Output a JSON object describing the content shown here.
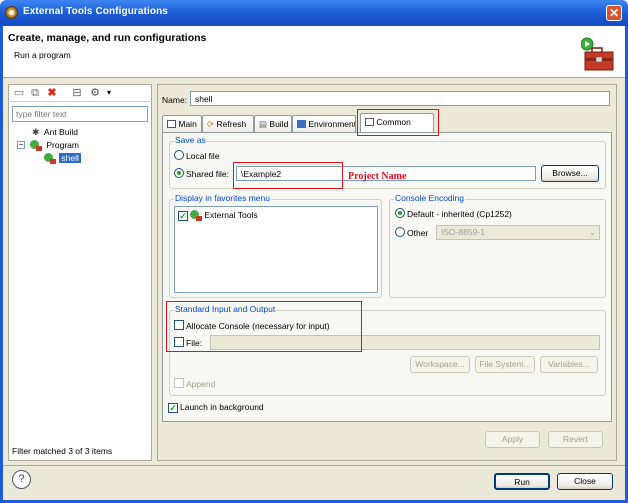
{
  "window": {
    "title": "External Tools Configurations",
    "close_label": "✕"
  },
  "header": {
    "title": "Create, manage, and run configurations",
    "subtitle": "Run a program"
  },
  "left": {
    "filter_placeholder": "type filter text",
    "tree": [
      {
        "label": "Ant Build"
      },
      {
        "label": "Program"
      },
      {
        "label": "shell"
      }
    ],
    "status": "Filter matched 3 of 3 items"
  },
  "right": {
    "name_label": "Name:",
    "name_value": "shell",
    "tabs": [
      "Main",
      "Refresh",
      "Build",
      "Environment",
      "Common"
    ],
    "save_as": {
      "title": "Save as",
      "local_file": "Local file",
      "shared_file": "Shared file:",
      "shared_value": "\\Example2",
      "browse": "Browse..."
    },
    "favorites": {
      "title": "Display in favorites menu",
      "item": "External Tools"
    },
    "encoding": {
      "title": "Console Encoding",
      "default": "Default - inherited (Cp1252)",
      "other": "Other",
      "other_value": "ISO-8859-1"
    },
    "io": {
      "title": "Standard Input and Output",
      "allocate": "Allocate Console (necessary for input)",
      "file": "File:",
      "workspace": "Workspace...",
      "filesystem": "File System...",
      "variables": "Variables...",
      "append": "Append"
    },
    "launch_bg": "Launch in background",
    "apply": "Apply",
    "revert": "Revert"
  },
  "annotation": {
    "project_name": "Project Name"
  },
  "footer": {
    "help": "?",
    "run": "Run",
    "close": "Close"
  },
  "colors": {
    "accent": "#316ac5",
    "annotation": "#e01020",
    "title_bar": "#1e5fd8"
  }
}
